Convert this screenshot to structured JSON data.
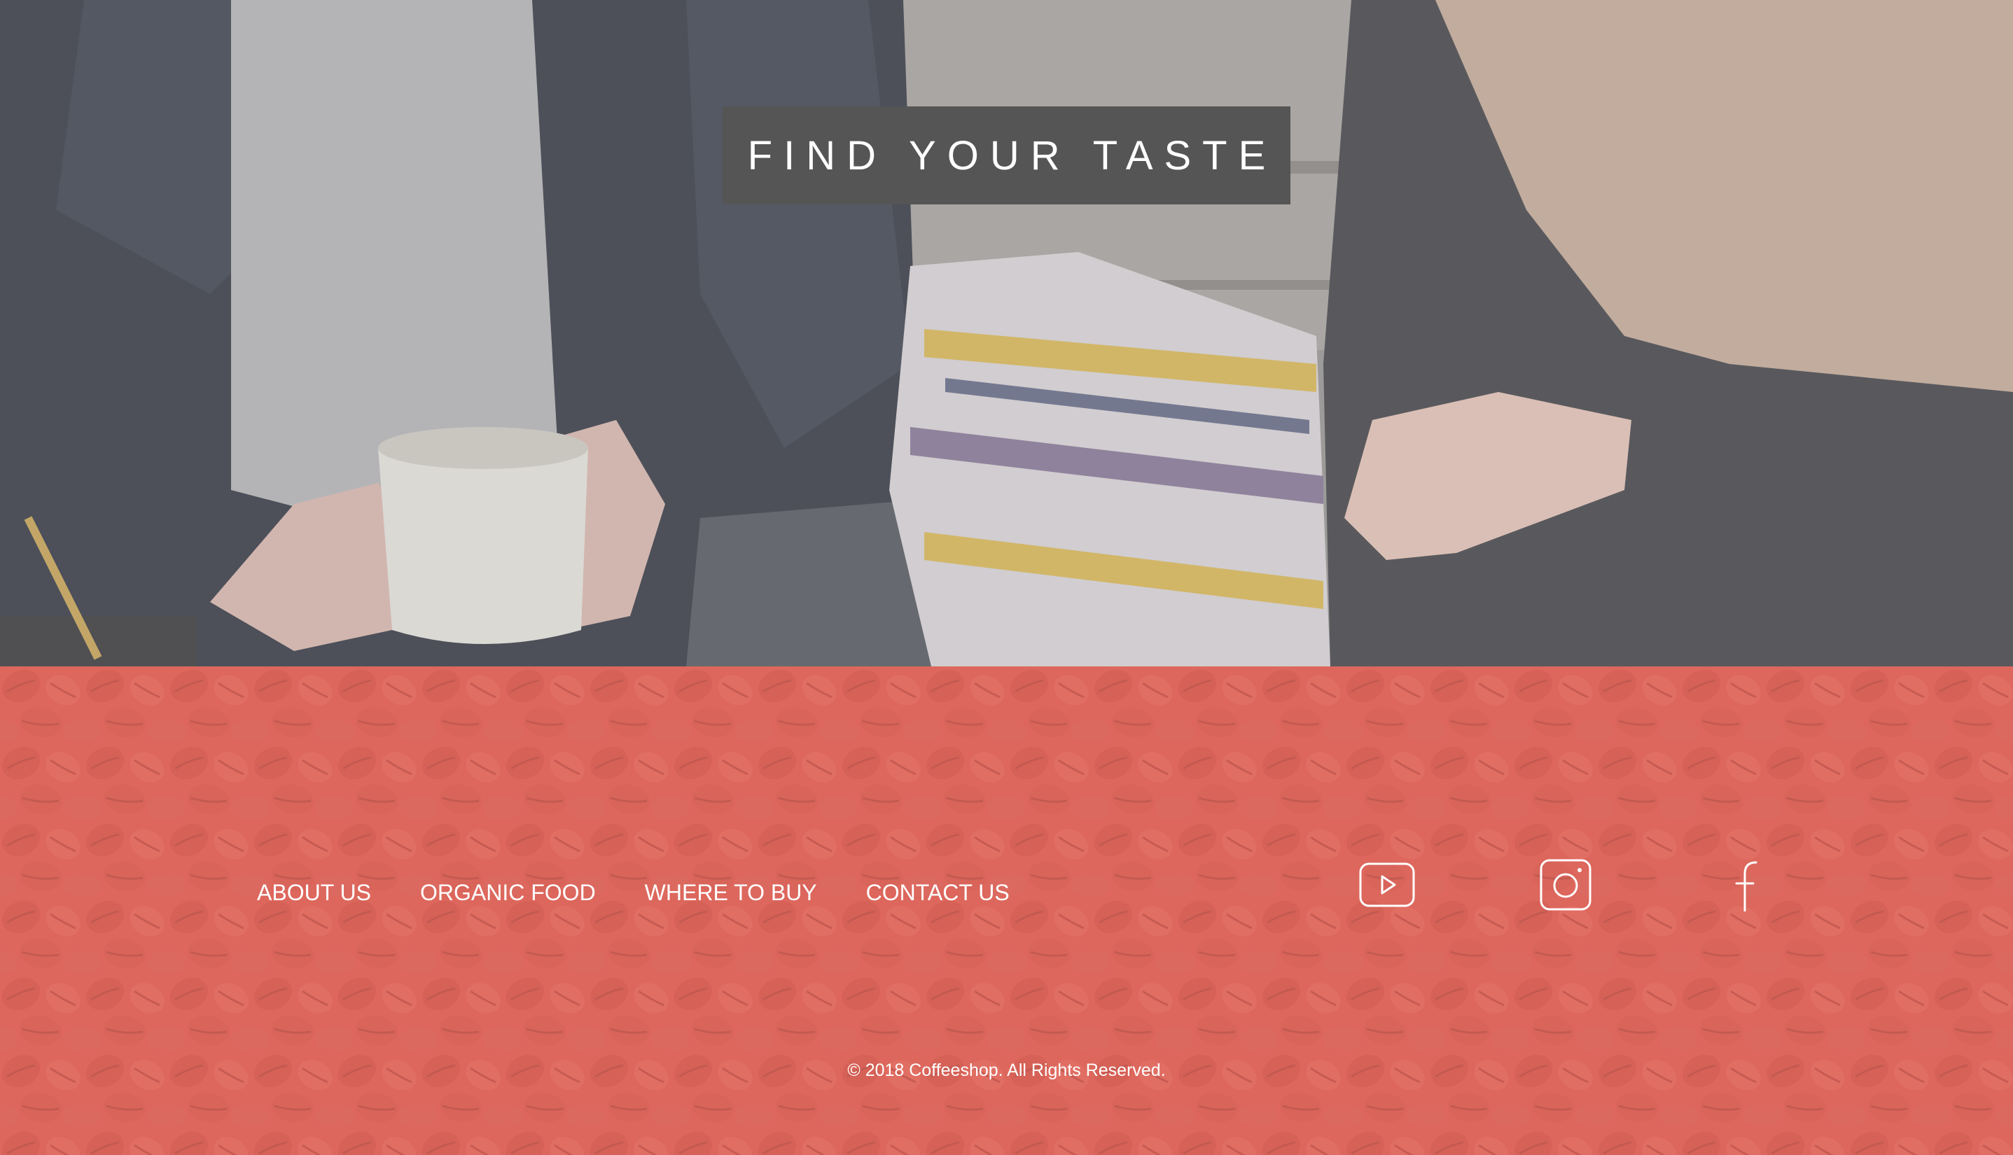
{
  "hero": {
    "title": "FIND YOUR TASTE"
  },
  "footer": {
    "nav": [
      {
        "label": "ABOUT US"
      },
      {
        "label": "ORGANIC FOOD"
      },
      {
        "label": "WHERE TO BUY"
      },
      {
        "label": "CONTACT US"
      }
    ],
    "social": [
      {
        "icon": "youtube-icon"
      },
      {
        "icon": "instagram-icon"
      },
      {
        "icon": "facebook-icon"
      }
    ],
    "copyright": "© 2018 Coffeeshop. All Rights Reserved."
  },
  "colors": {
    "badge_bg": "#555556",
    "footer_tint": "#e27a72",
    "text": "#ffffff"
  }
}
